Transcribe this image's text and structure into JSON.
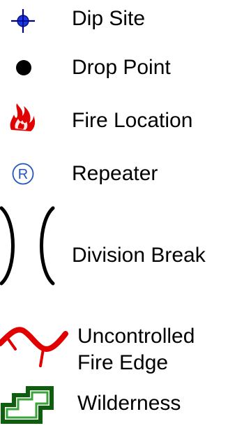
{
  "legend": {
    "items": [
      {
        "label": "Dip Site",
        "icon": "crosshair-circle-icon",
        "color": "#0000cc"
      },
      {
        "label": "Drop Point",
        "icon": "filled-circle-icon",
        "color": "#000000"
      },
      {
        "label": "Fire Location",
        "icon": "fire-icon",
        "color": "#e00000"
      },
      {
        "label": "Repeater",
        "icon": "registered-circle-icon",
        "color": "#2255bb"
      },
      {
        "label": "Division Break",
        "icon": "division-break-icon",
        "color": "#000000"
      },
      {
        "label_line1": "Uncontrolled",
        "label_line2": "Fire Edge",
        "icon": "uncontrolled-fire-edge-icon",
        "color": "#e00000"
      },
      {
        "label": "Wilderness",
        "icon": "wilderness-boundary-icon",
        "color": "#1a7a1a"
      }
    ]
  }
}
